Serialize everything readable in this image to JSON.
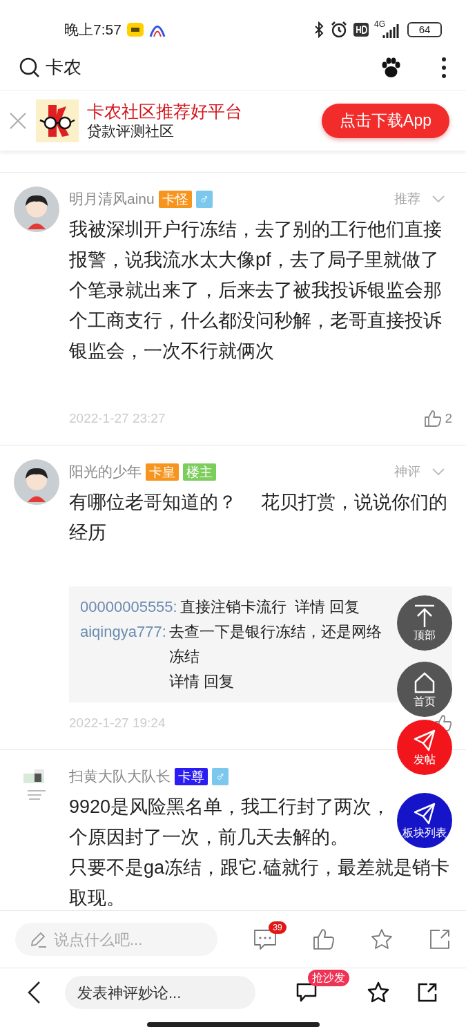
{
  "status_bar": {
    "time": "晚上7:57",
    "network": "4G",
    "battery": "64"
  },
  "search_bar": {
    "query": "卡农"
  },
  "banner": {
    "title": "卡农社区推荐好平台",
    "subtitle": "贷款评测社区",
    "button": "点击下载App"
  },
  "comments": [
    {
      "user": "明月清风ainu",
      "badges": [
        {
          "text": "卡怪",
          "color": "#f7941d"
        },
        {
          "text": "♂",
          "color": "#7cc7ee"
        }
      ],
      "tag": "推荐",
      "avatar": {
        "kind": "cartoon"
      },
      "body": [
        "我被深圳开户行冻结，去了别的工行他们直接报警，说我流水太大像pf，去了局子里就做了个笔录就出来了，后来去了被我投诉银监会那个工商支行，什么都没问秒解，老哥直接投诉银监会，一次不行就俩次"
      ],
      "time": "2022-1-27 23:27",
      "likes": "2"
    },
    {
      "user": "阳光的少年",
      "badges": [
        {
          "text": "卡皇",
          "color": "#f7941d"
        },
        {
          "text": "楼主",
          "color": "#7ccd5c"
        }
      ],
      "tag": "神评",
      "avatar": {
        "kind": "cartoon"
      },
      "body": [
        "有哪位老哥知道的？　 花贝打赏，说说你们的经历"
      ],
      "replies": [
        {
          "user": "00000005555:",
          "text": "直接注销卡流行",
          "links": [
            "详情",
            "回复"
          ]
        },
        {
          "user": "aiqingya777:",
          "text": "去查一下是银行冻结，还是网络冻结",
          "links": [
            "详情",
            "回复"
          ]
        }
      ],
      "time": "2022-1-27 19:24"
    },
    {
      "user": "扫黄大队大队长",
      "badges": [
        {
          "text": "卡尊",
          "color": "#2a1cf2"
        },
        {
          "text": "♂",
          "color": "#7cc7ee"
        }
      ],
      "avatar": {
        "kind": "picture"
      },
      "body": [
        "9920是风险黑名单，我工行封了两次，",
        "个原因封了一次，前几天去解的。",
        "只要不是ga冻结，跟它.磕就行，最差就是销卡取现。"
      ]
    }
  ],
  "floating_buttons": [
    {
      "label": "顶部",
      "kind": "top",
      "color": "#555555"
    },
    {
      "label": "首页",
      "kind": "home",
      "color": "#555555"
    },
    {
      "label": "发帖",
      "kind": "post",
      "color": "#f2161c"
    },
    {
      "label": "板块列表",
      "kind": "post",
      "color": "#1514c9"
    }
  ],
  "action_bar": {
    "placeholder": "说点什么吧...",
    "comment_count": "39"
  },
  "bottom_nav": {
    "placeholder": "发表神评妙论...",
    "badge": "抢沙发"
  }
}
